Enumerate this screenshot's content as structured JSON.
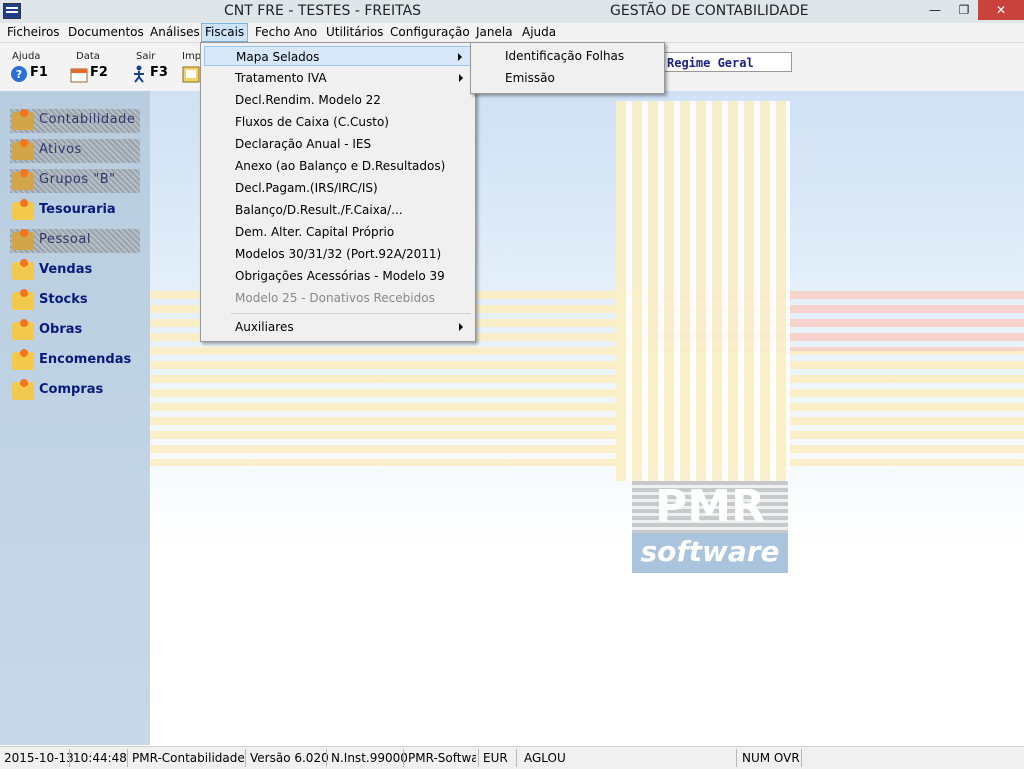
{
  "window": {
    "title_left": "CNT FRE - TESTES - FREITAS",
    "title_right": "GESTÃO DE CONTABILIDADE",
    "minimize": "—",
    "maximize": "❐",
    "close": "✕"
  },
  "menubar": {
    "items": [
      "Ficheiros",
      "Documentos",
      "Análises",
      "Fiscais",
      "Fecho Ano",
      "Utilitários",
      "Configuração",
      "Janela",
      "Ajuda"
    ],
    "active": "Fiscais"
  },
  "toolbar": {
    "buttons": [
      {
        "label": "Ajuda",
        "key": "F1",
        "icon": "help-icon"
      },
      {
        "label": "Data",
        "key": "F2",
        "icon": "calendar-icon"
      },
      {
        "label": "Sair",
        "key": "F3",
        "icon": "exit-icon"
      },
      {
        "label": "Imp",
        "key": "",
        "icon": "print-icon"
      }
    ],
    "regime": "Regime Geral"
  },
  "sidebar": {
    "items": [
      {
        "label": "Contabilidade",
        "enabled": false
      },
      {
        "label": "Ativos",
        "enabled": false
      },
      {
        "label": "Grupos \"B\"",
        "enabled": false
      },
      {
        "label": "Tesouraria",
        "enabled": true
      },
      {
        "label": "Pessoal",
        "enabled": false
      },
      {
        "label": "Vendas",
        "enabled": true
      },
      {
        "label": "Stocks",
        "enabled": true
      },
      {
        "label": "Obras",
        "enabled": true
      },
      {
        "label": "Encomendas",
        "enabled": true
      },
      {
        "label": "Compras",
        "enabled": true
      }
    ]
  },
  "fiscais_menu": {
    "items": [
      {
        "label": "Mapa Selados",
        "submenu": true,
        "enabled": true,
        "highlighted": true
      },
      {
        "label": "Tratamento IVA",
        "submenu": true,
        "enabled": true
      },
      {
        "label": "Decl.Rendim. Modelo 22",
        "submenu": false,
        "enabled": true
      },
      {
        "label": "Fluxos de Caixa (C.Custo)",
        "submenu": false,
        "enabled": true
      },
      {
        "label": "Declaração Anual - IES",
        "submenu": false,
        "enabled": true
      },
      {
        "label": "Anexo (ao Balanço e D.Resultados)",
        "submenu": false,
        "enabled": true
      },
      {
        "label": "Decl.Pagam.(IRS/IRC/IS)",
        "submenu": false,
        "enabled": true
      },
      {
        "label": "Balanço/D.Result./F.Caixa/...",
        "submenu": false,
        "enabled": true
      },
      {
        "label": "Dem. Alter. Capital Próprio",
        "submenu": false,
        "enabled": true
      },
      {
        "label": "Modelos 30/31/32 (Port.92A/2011)",
        "submenu": false,
        "enabled": true
      },
      {
        "label": "Obrigações Acessórias - Modelo 39",
        "submenu": false,
        "enabled": true
      },
      {
        "label": "Modelo 25 - Donativos Recebidos",
        "submenu": false,
        "enabled": false
      },
      {
        "label": "Auxiliares",
        "submenu": true,
        "enabled": true
      }
    ]
  },
  "mapa_selados_submenu": {
    "items": [
      "Identificação Folhas",
      "Emissão"
    ]
  },
  "logo": {
    "top": "PMR",
    "bottom": "software"
  },
  "statusbar": {
    "date": "2015-10-13",
    "time": "10:44:48",
    "app": "PMR-Contabilidade",
    "version": "Versão  6.020",
    "inst": "N.Inst.99000",
    "vendor": "PMR-Softwa",
    "currency": "EUR",
    "user": "AGLOU",
    "keys": "NUM OVR"
  }
}
